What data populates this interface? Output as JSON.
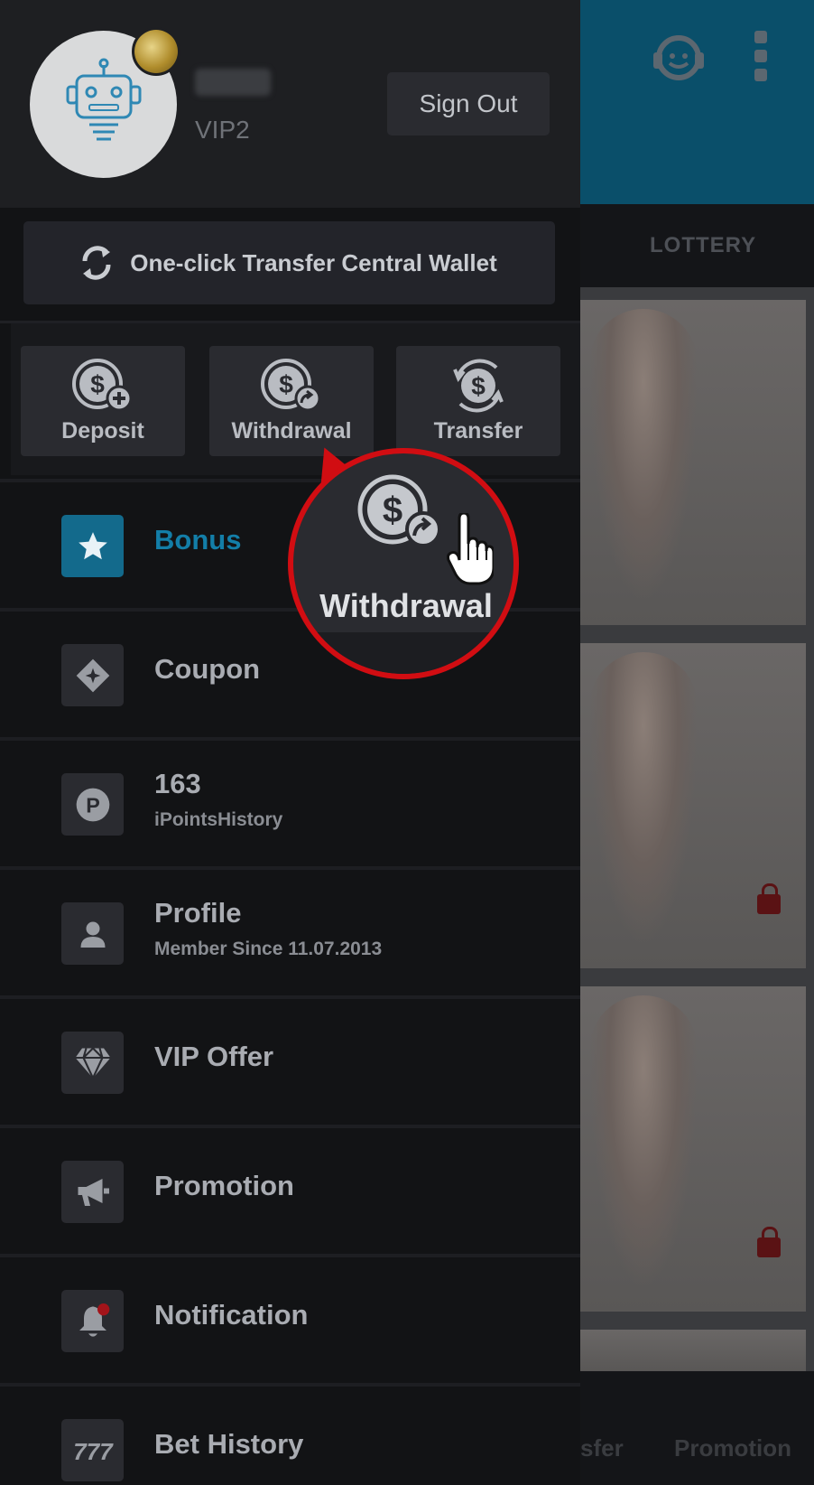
{
  "background": {
    "tab_label": "LOTTERY",
    "bottom_labels": [
      "sfer",
      "Promotion"
    ]
  },
  "header": {
    "vip_level": "VIP2",
    "sign_out_label": "Sign Out"
  },
  "transfer_all_label": "One-click Transfer Central Wallet",
  "quick_actions": [
    {
      "label": "Deposit",
      "icon": "dollar-plus-icon"
    },
    {
      "label": "Withdrawal",
      "icon": "dollar-arrow-icon"
    },
    {
      "label": "Transfer",
      "icon": "dollar-cycle-icon"
    }
  ],
  "menu": [
    {
      "title": "Bonus",
      "icon": "star-icon",
      "active": true
    },
    {
      "title": "Coupon",
      "icon": "ticket-icon"
    },
    {
      "title": "163",
      "subtitle": "iPointsHistory",
      "icon": "points-icon"
    },
    {
      "title": "Profile",
      "subtitle": "Member Since 11.07.2013",
      "icon": "user-icon"
    },
    {
      "title": "VIP Offer",
      "icon": "diamond-icon"
    },
    {
      "title": "Promotion",
      "icon": "megaphone-icon"
    },
    {
      "title": "Notification",
      "icon": "bell-icon"
    },
    {
      "title": "Bet History",
      "icon": "slot-777-icon"
    }
  ],
  "callout": {
    "label": "Withdrawal"
  },
  "colors": {
    "accent": "#137ea8",
    "callout_ring": "#d10d12",
    "drawer_bg": "#121315"
  }
}
